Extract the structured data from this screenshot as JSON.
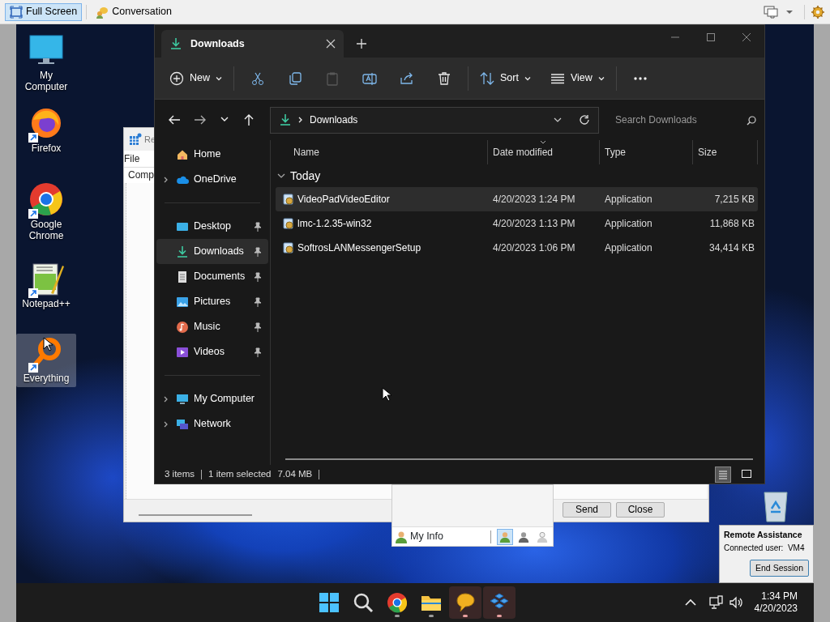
{
  "viewer_toolbar": {
    "buttons": [
      {
        "label": "Full Screen",
        "selected": true
      },
      {
        "label": "Conversation",
        "selected": false
      }
    ]
  },
  "desktop": {
    "icons": [
      {
        "label": "My Computer",
        "shortcut": false,
        "selected": false
      },
      {
        "label": "Firefox",
        "shortcut": true,
        "selected": false
      },
      {
        "label": "Google Chrome",
        "shortcut": true,
        "selected": false
      },
      {
        "label": "Notepad++",
        "shortcut": true,
        "selected": false
      },
      {
        "label": "Everything",
        "shortcut": true,
        "selected": true
      }
    ]
  },
  "background_window": {
    "title": "Re",
    "menu": [
      "File"
    ],
    "tab": "Comp",
    "buttons": [
      "Send",
      "Close"
    ]
  },
  "chat_bar": {
    "label": "My Info",
    "statuses": [
      {
        "selected": true
      },
      {
        "selected": false
      },
      {
        "selected": false
      }
    ]
  },
  "explorer": {
    "tabs": [
      {
        "label": "Downloads",
        "selected": true
      }
    ],
    "commands": {
      "new": "New",
      "actions": [
        {
          "disabled": false
        },
        {
          "disabled": false
        },
        {
          "disabled": true
        },
        {
          "disabled": false
        },
        {
          "disabled": false
        },
        {
          "disabled": false
        }
      ],
      "sort": "Sort",
      "view": "View"
    },
    "address": {
      "path": "Downloads"
    },
    "search": {
      "placeholder": "Search Downloads"
    },
    "sidebar": {
      "groups": [
        [
          {
            "label": "Home",
            "selected": false
          },
          {
            "label": "OneDrive",
            "selected": false,
            "expanded": false
          }
        ],
        [
          {
            "label": "Desktop",
            "selected": false,
            "pinned": true
          },
          {
            "label": "Downloads",
            "selected": true,
            "pinned": true
          },
          {
            "label": "Documents",
            "selected": false,
            "pinned": true
          },
          {
            "label": "Pictures",
            "selected": false,
            "pinned": true
          },
          {
            "label": "Music",
            "selected": false,
            "pinned": true
          },
          {
            "label": "Videos",
            "selected": false,
            "pinned": true
          }
        ],
        [
          {
            "label": "My Computer",
            "selected": false,
            "expanded": false
          },
          {
            "label": "Network",
            "selected": false,
            "expanded": false
          }
        ]
      ]
    },
    "columns": [
      {
        "label": "Name",
        "sorted": false
      },
      {
        "label": "Date modified",
        "sorted": true
      },
      {
        "label": "Type",
        "sorted": false
      },
      {
        "label": "Size",
        "sorted": false
      }
    ],
    "groups": [
      {
        "label": "Today",
        "expanded": true,
        "rows": [
          {
            "name": "VideoPadVideoEditor",
            "date": "4/20/2023 1:24 PM",
            "type": "Application",
            "size": "7,215 KB",
            "selected": true
          },
          {
            "name": "lmc-1.2.35-win32",
            "date": "4/20/2023 1:13 PM",
            "type": "Application",
            "size": "11,868 KB",
            "selected": false
          },
          {
            "name": "SoftrosLANMessengerSetup",
            "date": "4/20/2023 1:06 PM",
            "type": "Application",
            "size": "34,414 KB",
            "selected": false
          }
        ]
      }
    ],
    "status": {
      "count": "3 items",
      "selection": "1 item selected",
      "size": "7.04 MB"
    },
    "view_modes": [
      {
        "selected": true
      },
      {
        "selected": false
      }
    ]
  },
  "remote_assistance": {
    "title": "Remote Assistance",
    "user": "Connected user:  VM4",
    "button": "End Session"
  },
  "taskbar": {
    "apps": [
      {
        "running": false,
        "active": false
      },
      {
        "running": false,
        "active": false
      },
      {
        "running": true,
        "active": false
      },
      {
        "running": true,
        "active": false
      },
      {
        "running": true,
        "active": true
      },
      {
        "running": true,
        "active": true
      }
    ],
    "time": "1:34 PM",
    "date": "4/20/2023"
  }
}
